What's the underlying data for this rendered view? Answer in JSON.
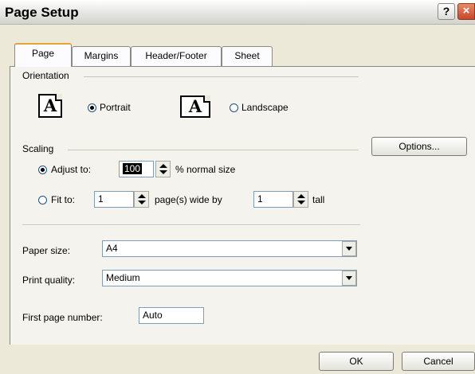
{
  "window": {
    "title": "Page Setup",
    "help_label": "?",
    "close_label": "×"
  },
  "tabs": [
    {
      "label": "Page",
      "active": true
    },
    {
      "label": "Margins",
      "active": false
    },
    {
      "label": "Header/Footer",
      "active": false
    },
    {
      "label": "Sheet",
      "active": false
    }
  ],
  "orientation": {
    "group_label": "Orientation",
    "icon_letter": "A",
    "portrait_label": "Portrait",
    "landscape_label": "Landscape",
    "selected": "portrait"
  },
  "scaling": {
    "group_label": "Scaling",
    "adjust_label": "Adjust to:",
    "adjust_value": "100",
    "adjust_suffix": "% normal size",
    "fit_label": "Fit to:",
    "fit_wide_value": "1",
    "fit_wide_suffix": "page(s) wide by",
    "fit_tall_value": "1",
    "fit_tall_suffix": "tall",
    "selected": "adjust"
  },
  "options_button": "Options...",
  "paper_size": {
    "label": "Paper size:",
    "value": "A4"
  },
  "print_quality": {
    "label": "Print quality:",
    "value": "Medium"
  },
  "first_page_number": {
    "label": "First page number:",
    "value": "Auto"
  },
  "buttons": {
    "ok": "OK",
    "cancel": "Cancel"
  },
  "colors": {
    "background": "#ece9d8",
    "tab_active_accent": "#e7a33a",
    "close_button": "#c8462a"
  }
}
